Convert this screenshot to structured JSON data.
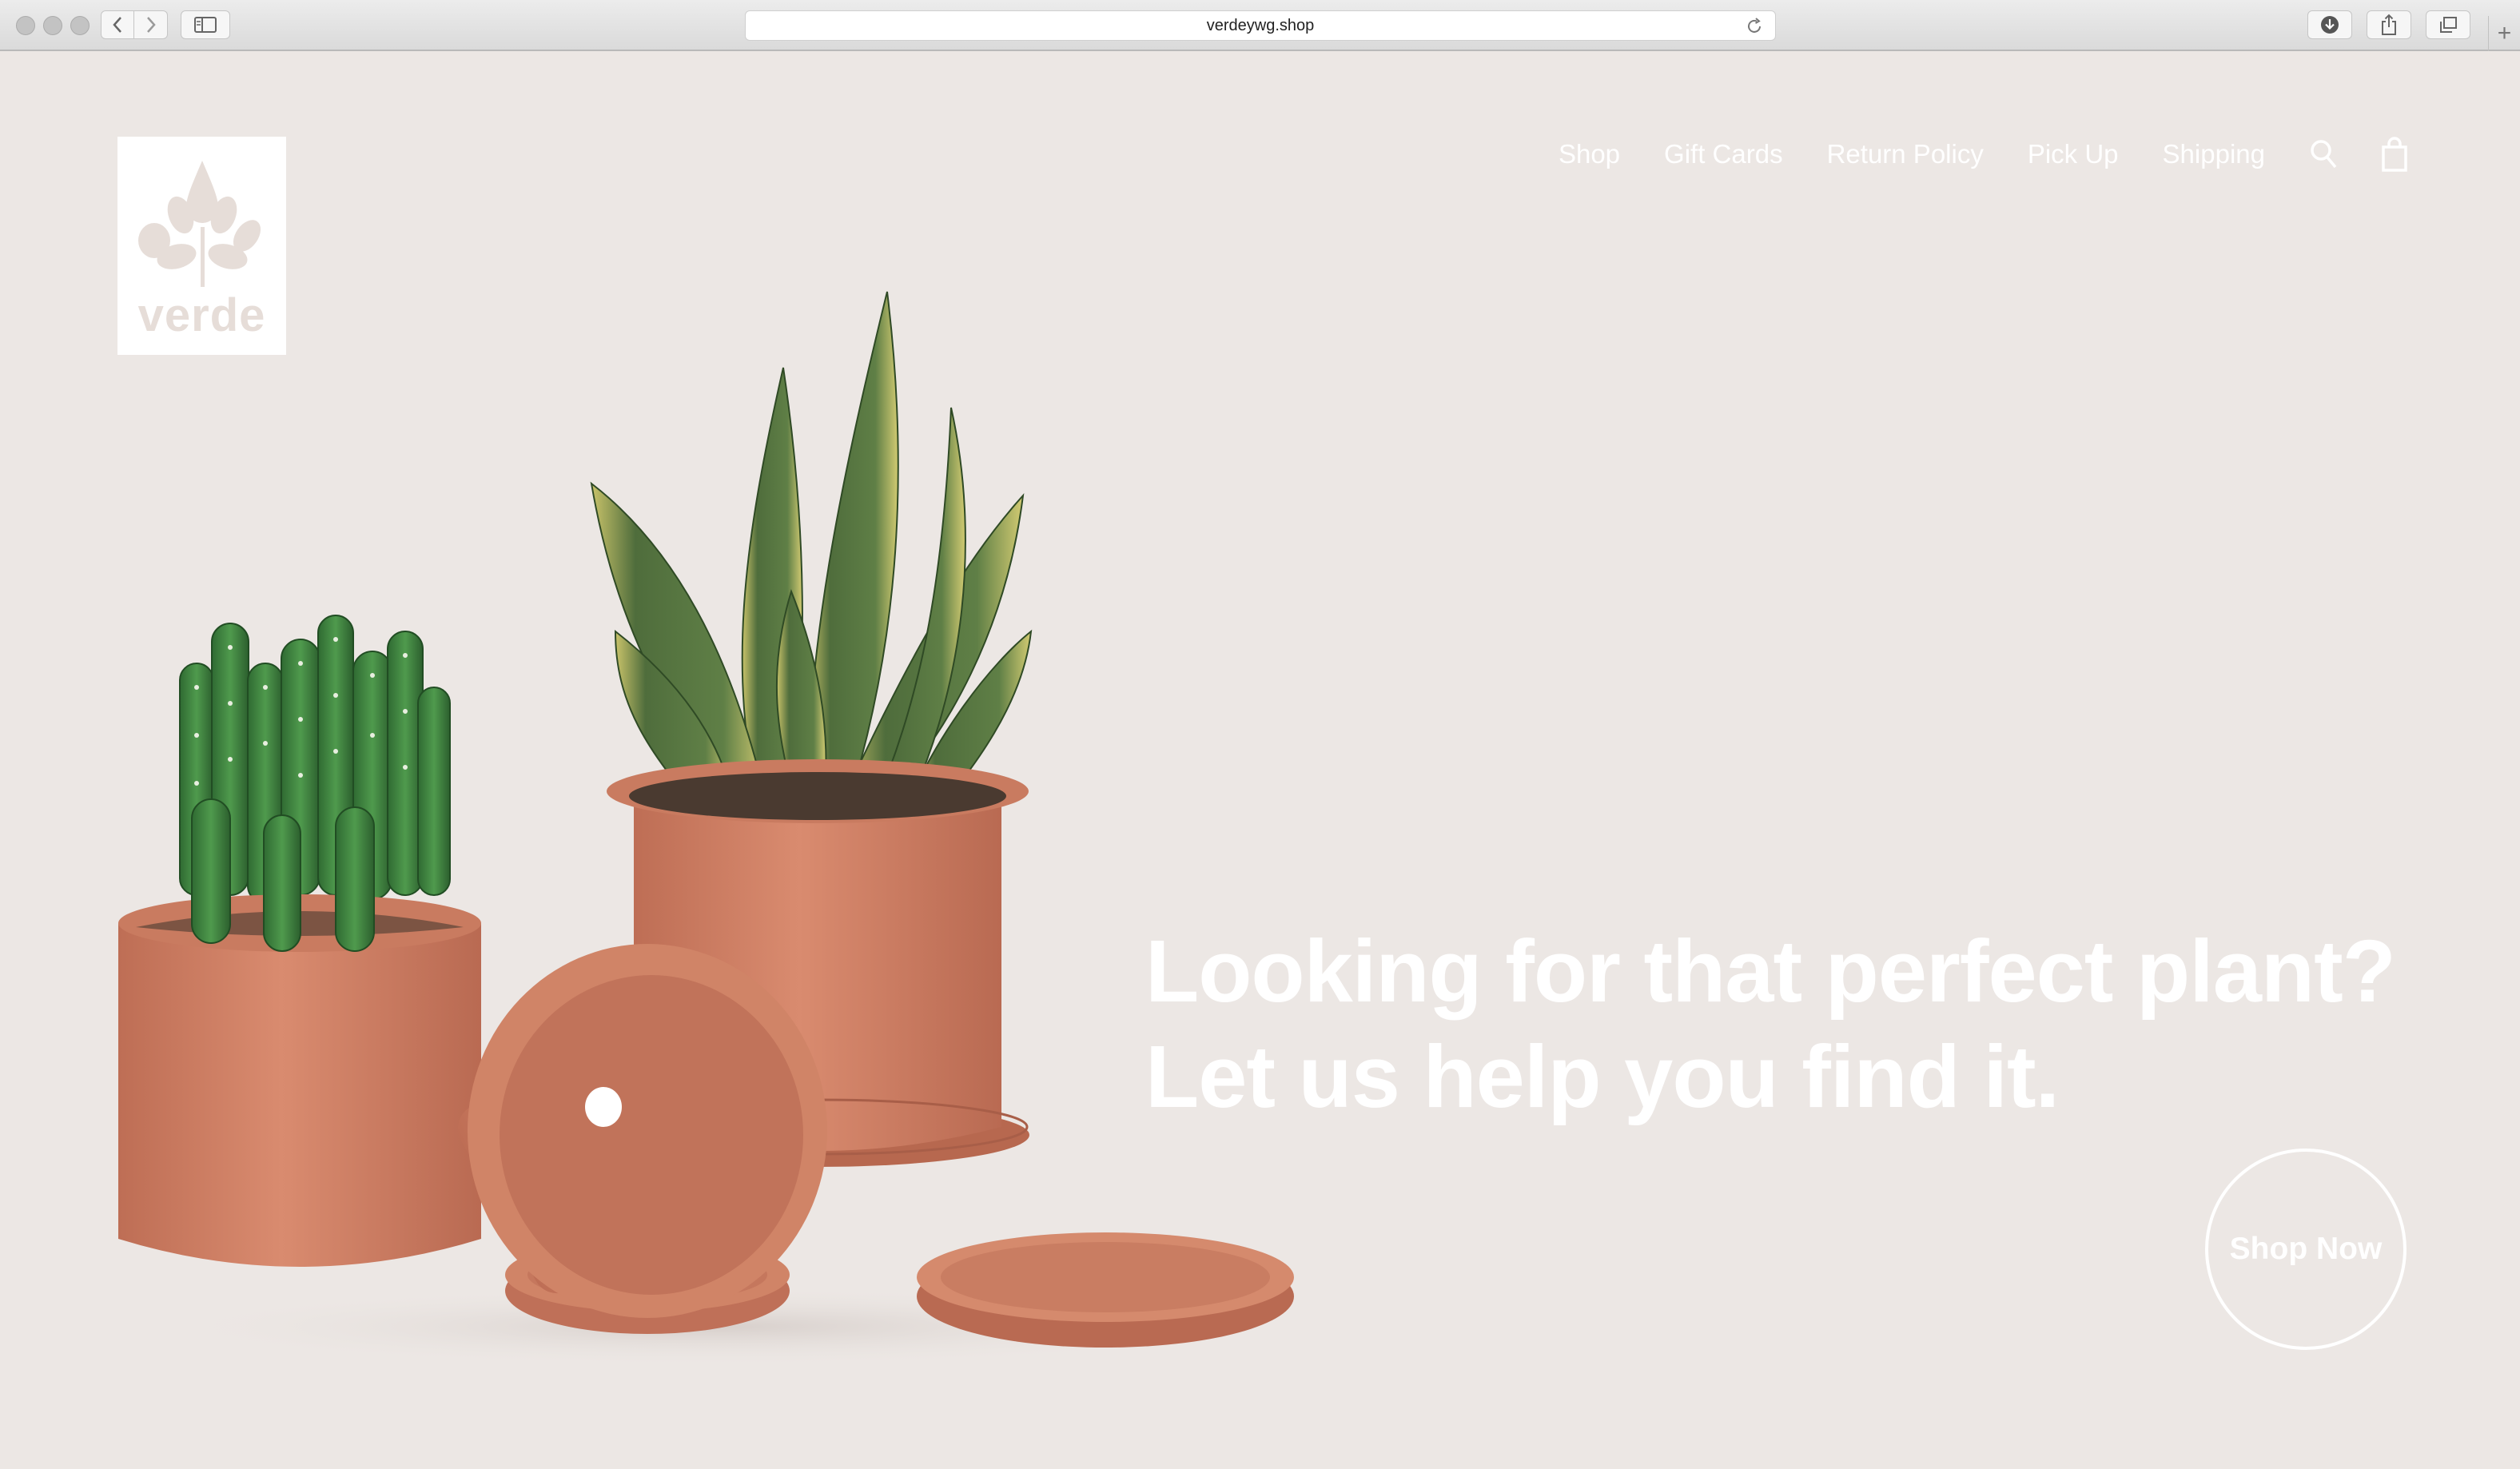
{
  "browser": {
    "url": "verdeywg.shop",
    "new_tab_symbol": "+",
    "icons": [
      "back-icon",
      "forward-icon",
      "sidebar-icon",
      "reload-icon",
      "download-icon",
      "share-icon",
      "tabs-icon"
    ]
  },
  "site": {
    "logo_text": "verde",
    "nav": {
      "items": [
        {
          "label": "Shop"
        },
        {
          "label": "Gift Cards"
        },
        {
          "label": "Return Policy"
        },
        {
          "label": "Pick Up"
        },
        {
          "label": "Shipping"
        }
      ],
      "icons": [
        "search-icon",
        "shopping-bag-icon"
      ]
    },
    "hero": {
      "headline_line1": "Looking for that perfect plant?",
      "headline_line2": "Let us help you find it.",
      "cta_label": "Shop Now"
    }
  },
  "colors": {
    "page_background": "#ece7e4",
    "terracotta": "#c9785e",
    "text": "#ffffff"
  }
}
